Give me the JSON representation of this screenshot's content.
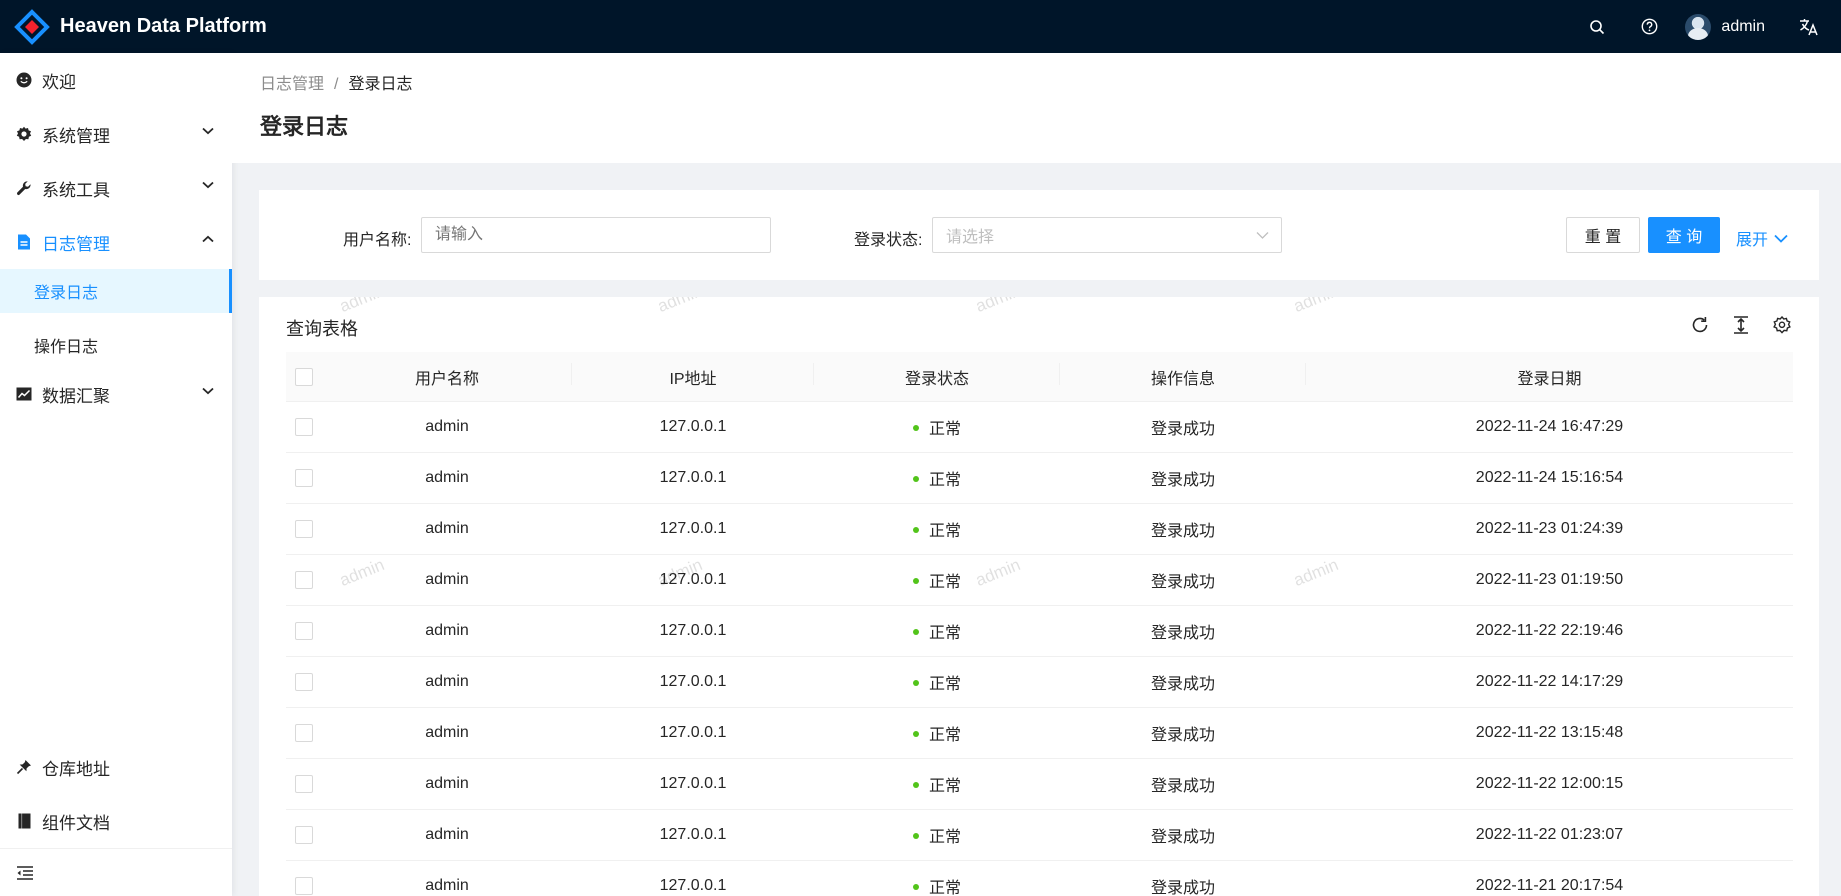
{
  "app": {
    "title": "Heaven Data Platform",
    "username": "admin"
  },
  "header_icons": [
    "search-icon",
    "help-icon",
    "translate-icon"
  ],
  "sidebar": {
    "items": [
      {
        "label": "欢迎",
        "icon": "smile-icon"
      },
      {
        "label": "系统管理",
        "icon": "setting-icon"
      },
      {
        "label": "系统工具",
        "icon": "tool-icon"
      },
      {
        "label": "日志管理",
        "icon": "file-text-icon"
      },
      {
        "label": "数据汇聚",
        "icon": "stock-icon"
      }
    ],
    "sub_items": [
      {
        "label": "登录日志",
        "active": true
      },
      {
        "label": "操作日志",
        "active": false
      }
    ],
    "bottom_items": [
      {
        "label": "仓库地址",
        "icon": "pushpin-icon"
      },
      {
        "label": "组件文档",
        "icon": "book-icon"
      }
    ]
  },
  "breadcrumb": {
    "parent": "日志管理",
    "separator": "/",
    "current": "登录日志"
  },
  "page_title": "登录日志",
  "search": {
    "username_label": "用户名称:",
    "username_placeholder": "请输入",
    "status_label": "登录状态:",
    "status_placeholder": "请选择",
    "reset_label": "重 置",
    "query_label": "查 询",
    "expand_label": "展开"
  },
  "table": {
    "title": "查询表格",
    "columns": [
      "用户名称",
      "IP地址",
      "登录状态",
      "操作信息",
      "登录日期"
    ],
    "rows": [
      {
        "user": "admin",
        "ip": "127.0.0.1",
        "status": "正常",
        "info": "登录成功",
        "date": "2022-11-24 16:47:29"
      },
      {
        "user": "admin",
        "ip": "127.0.0.1",
        "status": "正常",
        "info": "登录成功",
        "date": "2022-11-24 15:16:54"
      },
      {
        "user": "admin",
        "ip": "127.0.0.1",
        "status": "正常",
        "info": "登录成功",
        "date": "2022-11-23 01:24:39"
      },
      {
        "user": "admin",
        "ip": "127.0.0.1",
        "status": "正常",
        "info": "登录成功",
        "date": "2022-11-23 01:19:50"
      },
      {
        "user": "admin",
        "ip": "127.0.0.1",
        "status": "正常",
        "info": "登录成功",
        "date": "2022-11-22 22:19:46"
      },
      {
        "user": "admin",
        "ip": "127.0.0.1",
        "status": "正常",
        "info": "登录成功",
        "date": "2022-11-22 14:17:29"
      },
      {
        "user": "admin",
        "ip": "127.0.0.1",
        "status": "正常",
        "info": "登录成功",
        "date": "2022-11-22 13:15:48"
      },
      {
        "user": "admin",
        "ip": "127.0.0.1",
        "status": "正常",
        "info": "登录成功",
        "date": "2022-11-22 12:00:15"
      },
      {
        "user": "admin",
        "ip": "127.0.0.1",
        "status": "正常",
        "info": "登录成功",
        "date": "2022-11-22 01:23:07"
      },
      {
        "user": "admin",
        "ip": "127.0.0.1",
        "status": "正常",
        "info": "登录成功",
        "date": "2022-11-21 20:17:54"
      }
    ]
  },
  "watermark": "admin",
  "colors": {
    "header_bg": "#001529",
    "primary": "#1890ff",
    "status_ok": "#52c41a"
  }
}
